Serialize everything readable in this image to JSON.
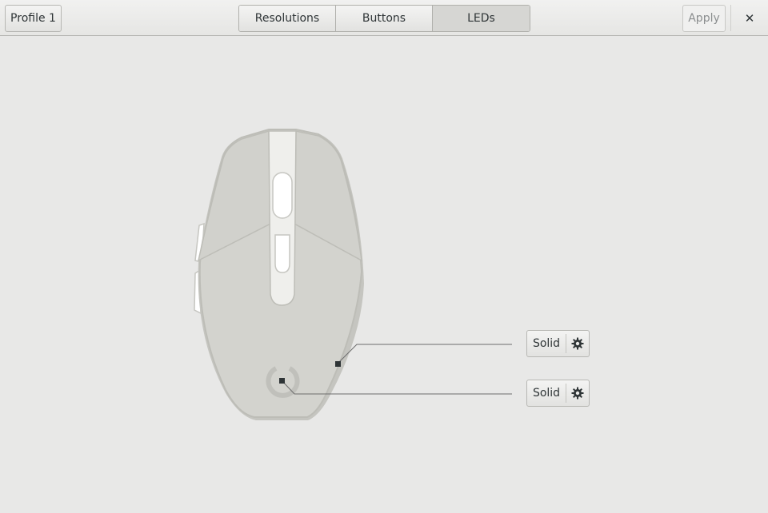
{
  "header": {
    "profile_label": "Profile 1",
    "tabs": [
      {
        "label": "Resolutions",
        "active": false
      },
      {
        "label": "Buttons",
        "active": false
      },
      {
        "label": "LEDs",
        "active": true
      }
    ],
    "apply_label": "Apply",
    "apply_enabled": false,
    "close_glyph": "✕"
  },
  "leds": [
    {
      "mode_label": "Solid",
      "settings_icon": "gear-icon"
    },
    {
      "mode_label": "Solid",
      "settings_icon": "gear-icon"
    }
  ],
  "colors": {
    "background": "#e8e8e7",
    "mouse_body": "#d3d3ce",
    "mouse_outline": "#bdbdb7",
    "led_marker": "#2e3436"
  }
}
